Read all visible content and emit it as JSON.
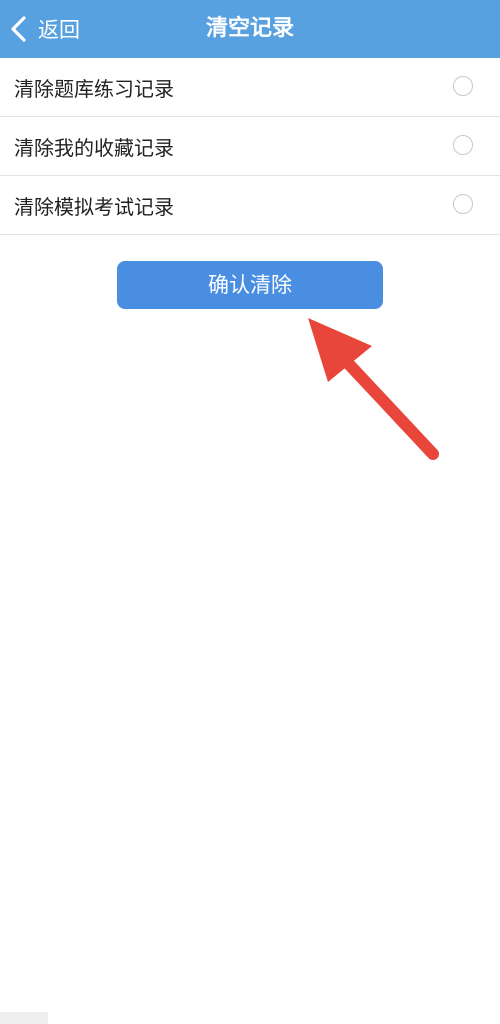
{
  "header": {
    "back_label": "返回",
    "title": "清空记录",
    "bg_color": "#58a1e0"
  },
  "options": [
    {
      "label": "清除题库练习记录",
      "selected": false
    },
    {
      "label": "清除我的收藏记录",
      "selected": false
    },
    {
      "label": "清除模拟考试记录",
      "selected": false
    }
  ],
  "confirm_button": {
    "label": "确认清除",
    "color": "#4a8ee2"
  },
  "annotation": {
    "arrow_color": "#e8463b",
    "icon": "red-pointer-arrow-icon"
  }
}
